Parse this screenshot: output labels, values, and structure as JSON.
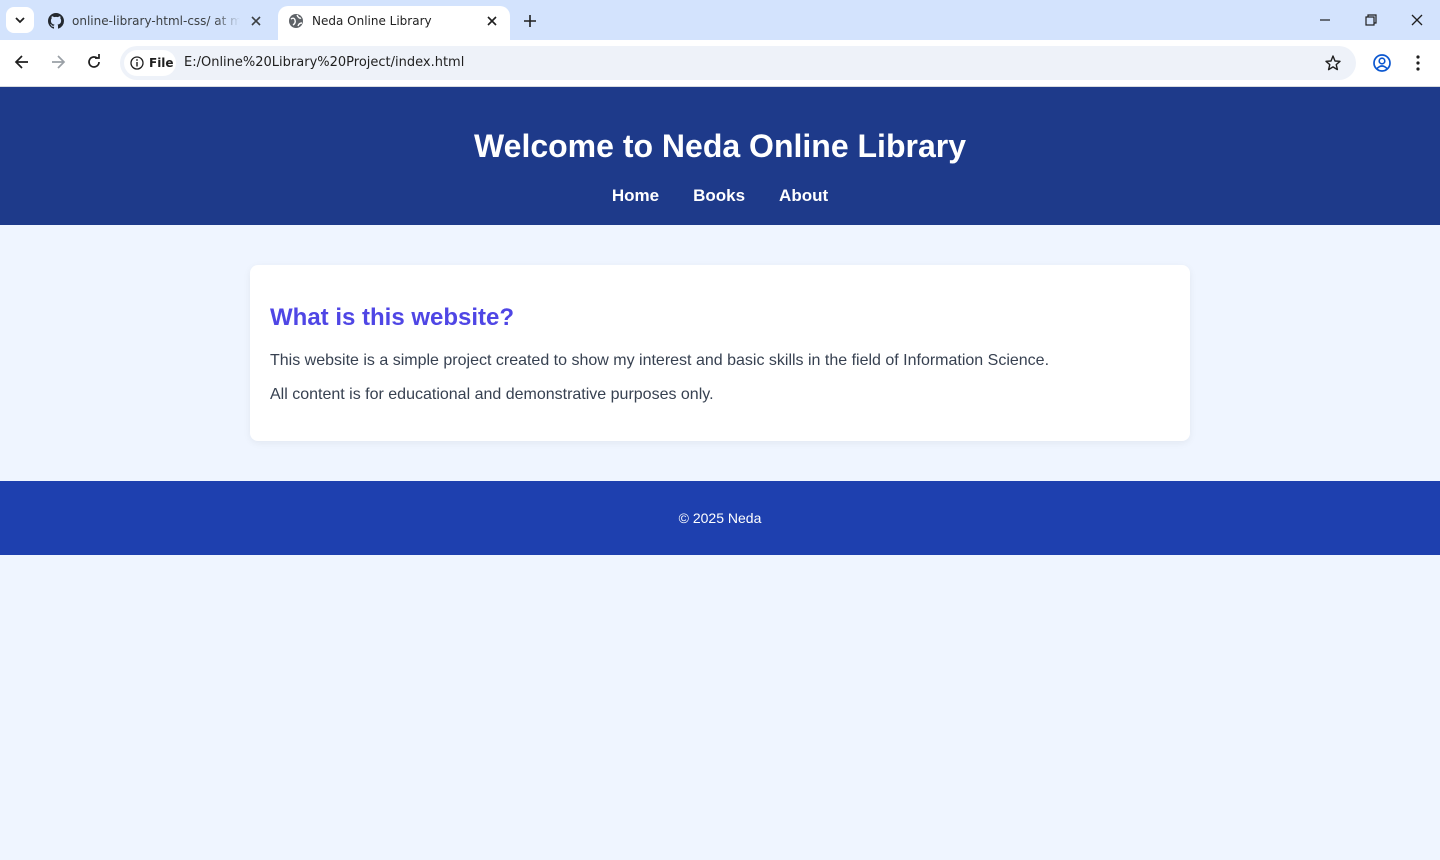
{
  "browser": {
    "tabs": [
      {
        "title": "online-library-html-css/ at main",
        "active": false,
        "favicon": "github-icon"
      },
      {
        "title": "Neda Online Library",
        "active": true,
        "favicon": "globe-icon"
      }
    ],
    "address": {
      "chip_label": "File",
      "url": "E:/Online%20Library%20Project/index.html"
    }
  },
  "site": {
    "title": "Welcome to Neda Online Library",
    "nav": [
      "Home",
      "Books",
      "About"
    ],
    "section": {
      "heading": "What is this website?",
      "paragraphs": [
        "This website is a simple project created to show my interest and basic skills in the field of Information Science.",
        "All content is for educational and demonstrative purposes only."
      ]
    },
    "footer": "© 2025 Neda"
  },
  "colors": {
    "header_bg": "#1e3a8a",
    "footer_bg": "#1e40af",
    "heading": "#4f46e5",
    "page_bg": "#eff5ff"
  }
}
